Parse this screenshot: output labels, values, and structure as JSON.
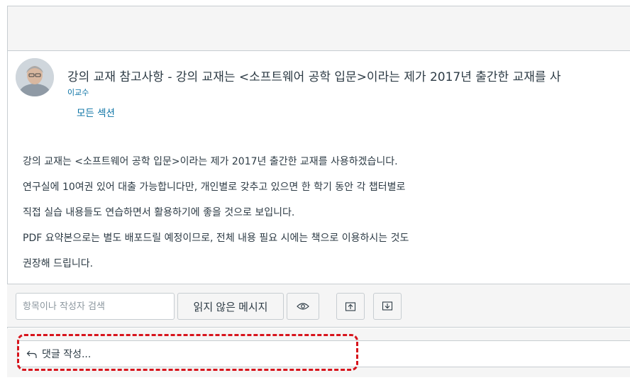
{
  "post": {
    "title": "강의 교재 참고사항 - 강의 교재는 <소프트웨어 공학 입문>이라는 제가 2017년 출간한 교재를 사",
    "author": "이교수",
    "sections": "모든 섹션",
    "body": [
      "강의 교재는 <소프트웨어 공학 입문>이라는 제가 2017년 출간한 교재를 사용하겠습니다.",
      "연구실에 10여권 있어 대출 가능합니다만, 개인별로 갖추고 있으면 한 학기 동안 각 챕터별로",
      "직접 실습 내용들도 연습하면서 활용하기에 좋을 것으로 보입니다.",
      "PDF 요약본으로는 별도 배포드릴 예정이므로, 전체 내용 필요 시에는 책으로 이용하시는 것도",
      "권장해 드립니다."
    ]
  },
  "toolbar": {
    "search_placeholder": "항목이나 작성자 검색",
    "unread_label": "읽지 않은 메시지",
    "icons": [
      "eye-icon",
      "collapse-up-icon",
      "expand-down-icon"
    ]
  },
  "reply": {
    "placeholder": "댓글 작성...",
    "icon": "reply-arrow-icon"
  },
  "colors": {
    "link": "#0770a3",
    "text": "#2d3b45",
    "border": "#c7cdd1",
    "panel": "#f5f5f5",
    "highlight": "#d7141c"
  }
}
